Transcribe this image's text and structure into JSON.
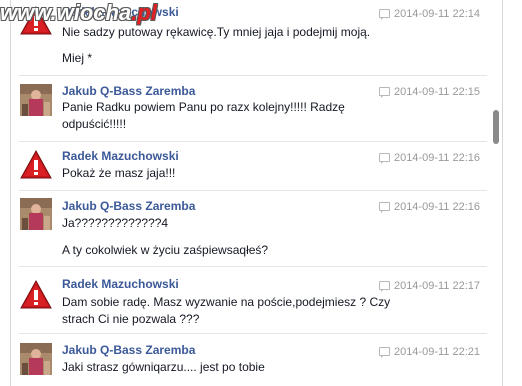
{
  "watermark": {
    "part1": "www.",
    "part2": "wiocha",
    "part3": ".pl"
  },
  "messages": [
    {
      "author": "Radek Mazuchowski",
      "avatar_icon": "warning-icon",
      "timestamp": "2014-09-11 22:14",
      "lines": [
        "Nie sadzy putoway rękawicę.Ty mniej jaja i podejmij moją.",
        "Miej *"
      ]
    },
    {
      "author": "Jakub Q-Bass Zaremba",
      "avatar_icon": "user-photo",
      "timestamp": "2014-09-11 22:15",
      "lines": [
        "Panie Radku powiem Panu po razx kolejny!!!!! Radzę",
        "odpuścić!!!!!"
      ]
    },
    {
      "author": "Radek Mazuchowski",
      "avatar_icon": "warning-icon",
      "timestamp": "2014-09-11 22:16",
      "lines": [
        "Pokaż że masz jaja!!!"
      ]
    },
    {
      "author": "Jakub Q-Bass Zaremba",
      "avatar_icon": "user-photo",
      "timestamp": "2014-09-11 22:16",
      "lines": [
        "Ja?????????????4",
        "A ty cokolwiek w życiu zaśpiewsaqłeś?"
      ]
    },
    {
      "author": "Radek Mazuchowski",
      "avatar_icon": "warning-icon",
      "timestamp": "2014-09-11 22:17",
      "lines": [
        "Dam sobie radę. Masz wyzwanie na poście,podejmiesz ? Czy",
        "strach Ci nie pozwala ???"
      ]
    },
    {
      "author": "Jakub Q-Bass Zaremba",
      "avatar_icon": "user-photo",
      "timestamp": "2014-09-11 22:21",
      "lines": [
        "Jaki strasz gówniqarzu.... jest po tobie"
      ]
    }
  ]
}
